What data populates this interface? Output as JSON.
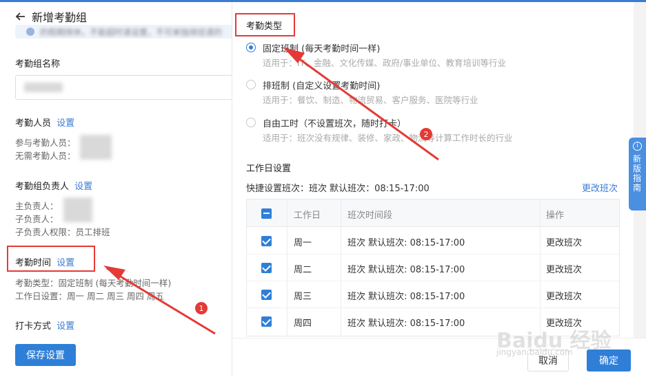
{
  "left": {
    "title": "新增考勤组",
    "notice": "的假期排休，不能超时请设置，不可单独排班请的",
    "group_name_label": "考勤组名称",
    "members": {
      "label": "考勤人员",
      "link": "设置",
      "attend": "参与考勤人员：",
      "exempt": "无需考勤人员："
    },
    "managers": {
      "label": "考勤组负责人",
      "link": "设置",
      "main": "主负责人：",
      "sub": "子负责人：",
      "perm": "子负责人权限：员工排班"
    },
    "time": {
      "label": "考勤时间",
      "link": "设置",
      "type": "考勤类型：固定班制 (每天考勤时间一样)",
      "workdays": "工作日设置：周一 周二 周三 周四 周五"
    },
    "punch": {
      "label": "打卡方式",
      "link": "设置"
    },
    "save": "保存设置"
  },
  "right": {
    "type_title": "考勤类型",
    "options": [
      {
        "title": "固定班制 (每天考勤时间一样)",
        "desc": "适用于：IT、金融、文化传媒、政府/事业单位、教育培训等行业",
        "selected": true
      },
      {
        "title": "排班制 (自定义设置考勤时间)",
        "desc": "适用于：餐饮、制造、物流贸易、客户服务、医院等行业",
        "selected": false
      },
      {
        "title": "自由工时（不设置班次，随时打卡）",
        "desc": "适用于：班次没有规律、装修、家政、物流等计算工作时长的行业",
        "selected": false
      }
    ],
    "workday_title": "工作日设置",
    "quick": "快捷设置班次：班次 默认班次：08:15-17:00",
    "change_all": "更改班次",
    "table": {
      "headers": [
        "工作日",
        "班次时间段",
        "操作"
      ],
      "rows": [
        {
          "day": "周一",
          "shift": "班次 默认班次: 08:15-17:00",
          "action": "更改班次"
        },
        {
          "day": "周二",
          "shift": "班次 默认班次: 08:15-17:00",
          "action": "更改班次"
        },
        {
          "day": "周三",
          "shift": "班次 默认班次: 08:15-17:00",
          "action": "更改班次"
        },
        {
          "day": "周四",
          "shift": "班次 默认班次: 08:15-17:00",
          "action": "更改班次"
        }
      ]
    },
    "cancel": "取消",
    "confirm": "确定"
  },
  "guide": {
    "text": "新版指南",
    "icon": "info-icon"
  },
  "annotations": {
    "badge1": "1",
    "badge2": "2"
  },
  "watermark": {
    "main": "Baidu 经验",
    "sub": "jingyan.baidu.com"
  },
  "colors": {
    "accent": "#2f7fd8",
    "annotation": "#e53935"
  }
}
